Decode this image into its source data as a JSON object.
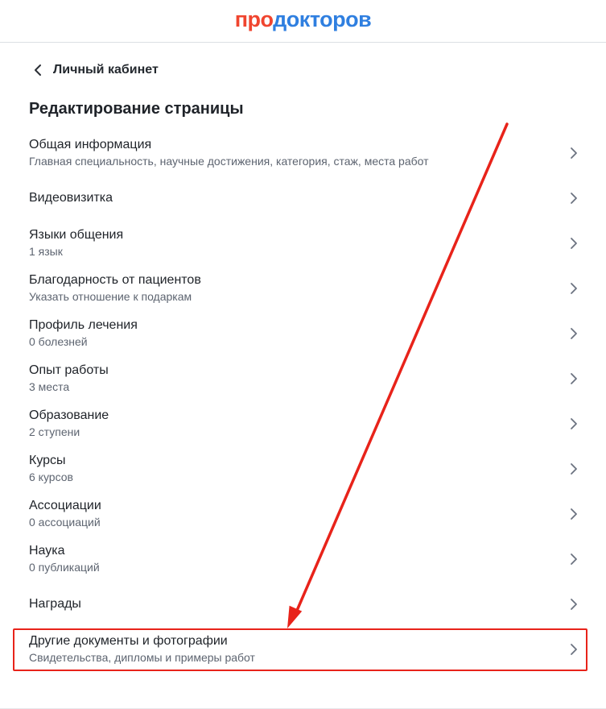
{
  "header": {
    "logo_part1": "про",
    "logo_part2": "докторов"
  },
  "nav": {
    "back_label": "Личный кабинет"
  },
  "page": {
    "title": "Редактирование страницы"
  },
  "items": [
    {
      "label": "Общая информация",
      "sub": "Главная специальность, научные достижения, категория, стаж, места работ"
    },
    {
      "label": "Видеовизитка",
      "sub": ""
    },
    {
      "label": "Языки общения",
      "sub": "1 язык"
    },
    {
      "label": "Благодарность от пациентов",
      "sub": "Указать отношение к подаркам"
    },
    {
      "label": "Профиль лечения",
      "sub": "0 болезней"
    },
    {
      "label": "Опыт работы",
      "sub": "3 места"
    },
    {
      "label": "Образование",
      "sub": "2 ступени"
    },
    {
      "label": "Курсы",
      "sub": "6 курсов"
    },
    {
      "label": "Ассоциации",
      "sub": "0 ассоциаций"
    },
    {
      "label": "Наука",
      "sub": "0 публикаций"
    },
    {
      "label": "Награды",
      "sub": ""
    },
    {
      "label": "Другие документы и фотографии",
      "sub": "Свидетельства, дипломы и примеры работ"
    }
  ],
  "colors": {
    "logo_red": "#f0452f",
    "logo_blue": "#2f7fe0",
    "annotation_red": "#e8231a"
  }
}
